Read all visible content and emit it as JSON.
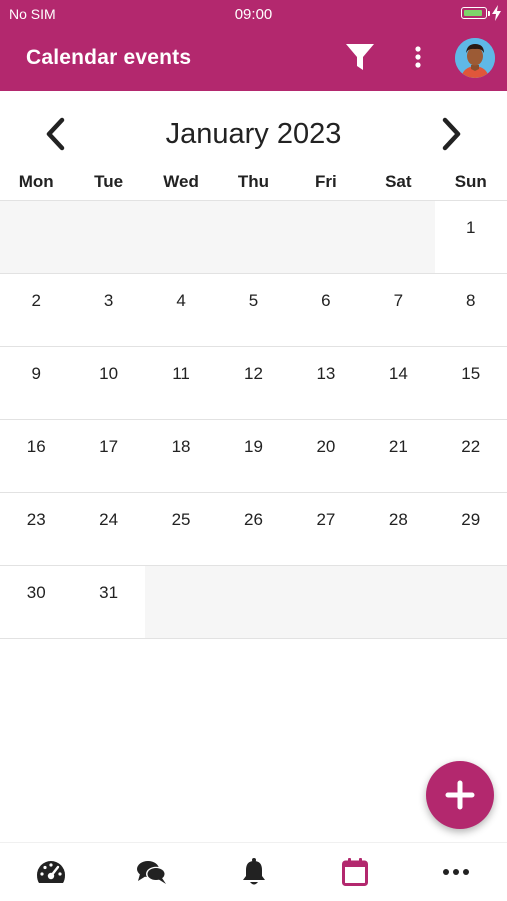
{
  "status_bar": {
    "carrier": "No SIM",
    "time": "09:00"
  },
  "header": {
    "title": "Calendar events",
    "filter_icon": "filter-icon",
    "more_icon": "more-vertical-icon",
    "avatar": "user-avatar"
  },
  "calendar": {
    "month_label": "January 2023",
    "prev_icon": "chevron-left-icon",
    "next_icon": "chevron-right-icon",
    "weekdays": [
      "Mon",
      "Tue",
      "Wed",
      "Thu",
      "Fri",
      "Sat",
      "Sun"
    ],
    "weeks": [
      [
        "",
        "",
        "",
        "",
        "",
        "",
        "1"
      ],
      [
        "2",
        "3",
        "4",
        "5",
        "6",
        "7",
        "8"
      ],
      [
        "9",
        "10",
        "11",
        "12",
        "13",
        "14",
        "15"
      ],
      [
        "16",
        "17",
        "18",
        "19",
        "20",
        "21",
        "22"
      ],
      [
        "23",
        "24",
        "25",
        "26",
        "27",
        "28",
        "29"
      ],
      [
        "30",
        "31",
        "",
        "",
        "",
        "",
        ""
      ]
    ]
  },
  "fab": {
    "icon": "plus-icon"
  },
  "bottom_nav": {
    "items": [
      {
        "icon": "dashboard-icon",
        "active": false
      },
      {
        "icon": "chat-icon",
        "active": false
      },
      {
        "icon": "bell-icon",
        "active": false
      },
      {
        "icon": "calendar-icon",
        "active": true
      },
      {
        "icon": "more-horizontal-icon",
        "active": false
      }
    ]
  },
  "colors": {
    "accent": "#b3286e",
    "battery": "#7dd56b",
    "nav_icon": "#222222"
  }
}
